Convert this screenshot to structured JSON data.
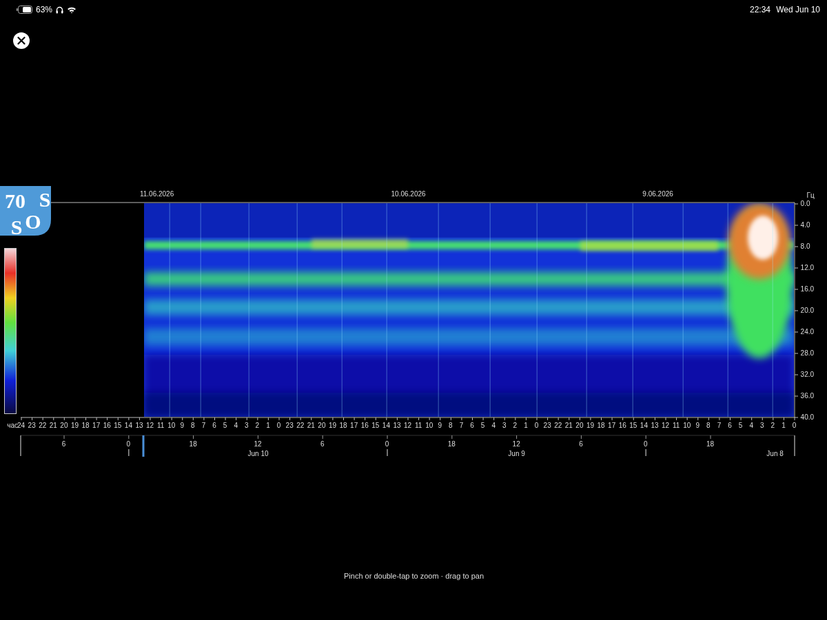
{
  "status_bar": {
    "time": "22:34",
    "date": "Wed Jun 10",
    "battery_percent": "63%"
  },
  "logo": {
    "letters": [
      "70",
      "S",
      "S",
      "O"
    ]
  },
  "spectrogram": {
    "date_labels": [
      "11.06.2026",
      "10.06.2026",
      "9.06.2026"
    ],
    "y_unit": "Гц",
    "y_ticks": [
      "0.0",
      "4.0",
      "8.0",
      "12.0",
      "16.0",
      "20.0",
      "24.0",
      "28.0",
      "32.0",
      "36.0",
      "40.0"
    ],
    "x_ticks": [
      "24",
      "23",
      "22",
      "21",
      "20",
      "19",
      "18",
      "17",
      "16",
      "15",
      "14",
      "13",
      "12",
      "11",
      "10",
      "9",
      "8",
      "7",
      "6",
      "5",
      "4",
      "3",
      "2",
      "1",
      "0",
      "23",
      "22",
      "21",
      "20",
      "19",
      "18",
      "17",
      "16",
      "15",
      "14",
      "13",
      "12",
      "11",
      "10",
      "9",
      "8",
      "7",
      "6",
      "5",
      "4",
      "3",
      "2",
      "1",
      "0",
      "23",
      "22",
      "21",
      "20",
      "19",
      "18",
      "17",
      "16",
      "15",
      "14",
      "13",
      "12",
      "11",
      "10",
      "9",
      "8",
      "7",
      "6",
      "5",
      "4",
      "3",
      "2",
      "1",
      "0"
    ],
    "x_unit": "час"
  },
  "timeline": {
    "ticks": [
      "6",
      "0",
      "18",
      "12",
      "6",
      "0",
      "18",
      "12",
      "6",
      "0",
      "18"
    ],
    "dates": [
      "Jun 10",
      "Jun 9",
      "Jun 8"
    ]
  },
  "hint": "Pinch or double-tap to zoom · drag to pan"
}
